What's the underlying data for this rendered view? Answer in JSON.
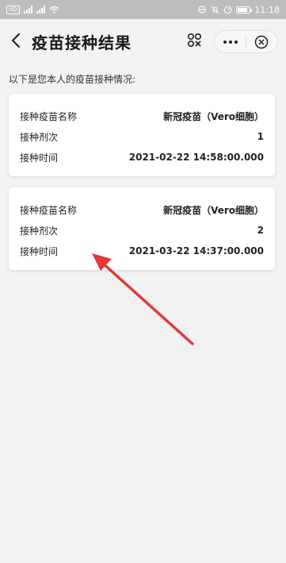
{
  "status_bar": {
    "hd_label": "HD",
    "sim_label": "4G",
    "time": "11:18",
    "icons": [
      "hd-icon",
      "signal-icon",
      "wifi-icon",
      "nfc-icon",
      "mute-icon",
      "data-saver-icon",
      "battery-icon"
    ]
  },
  "header": {
    "title": "疫苗接种结果",
    "back_icon": "chevron-left-icon",
    "scan_icon": "scan-code-icon",
    "more_icon": "more-dots-icon",
    "close_icon": "close-circle-icon"
  },
  "intro_text": "以下是您本人的疫苗接种情况:",
  "records": [
    {
      "name_label": "接种疫苗名称",
      "name_value": "新冠疫苗（Vero细胞）",
      "dose_label": "接种剂次",
      "dose_value": "1",
      "time_label": "接种时间",
      "time_value": "2021-02-22 14:58:00.000"
    },
    {
      "name_label": "接种疫苗名称",
      "name_value": "新冠疫苗（Vero细胞）",
      "dose_label": "接种剂次",
      "dose_value": "2",
      "time_label": "接种时间",
      "time_value": "2021-03-22 14:37:00.000"
    }
  ],
  "annotation": {
    "color": "#e23a3a"
  },
  "colors": {
    "background": "#f2f2f2",
    "card": "#ffffff",
    "status_bar": "#bdbdbd"
  }
}
